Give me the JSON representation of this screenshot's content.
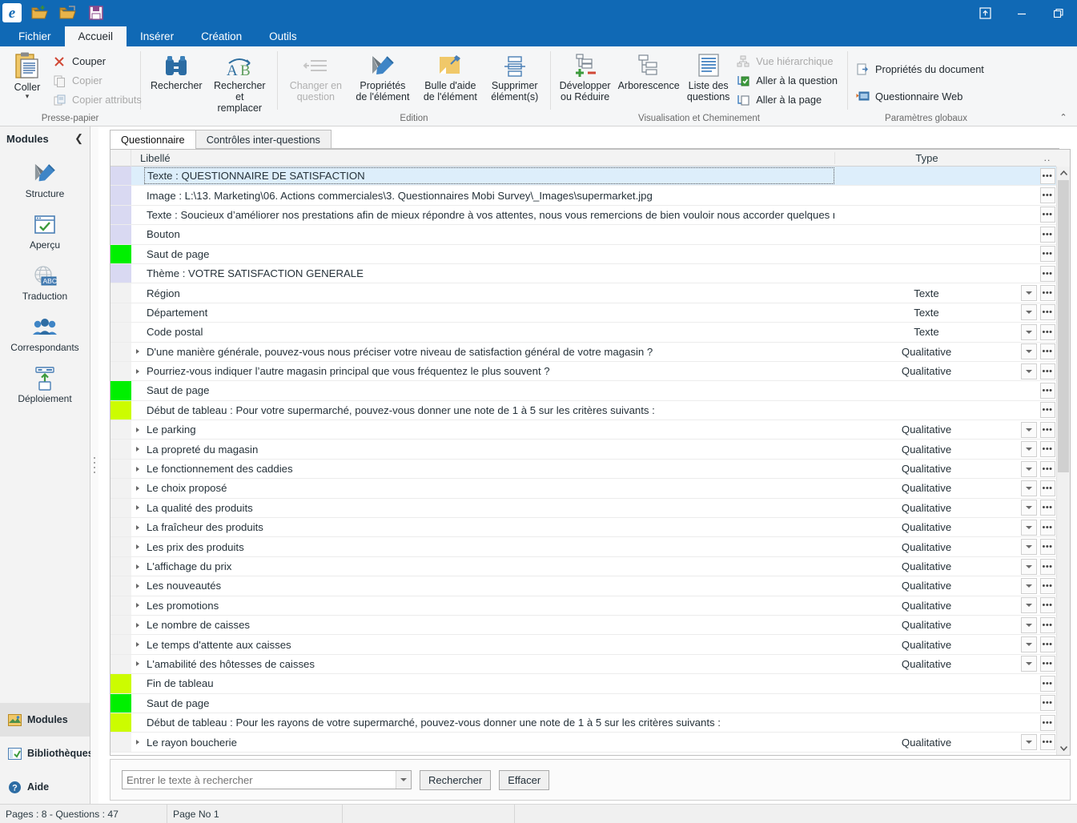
{
  "window": {
    "quick_access": [
      "app-logo",
      "open-icon",
      "open-recent-icon",
      "save-icon"
    ],
    "controls": [
      {
        "name": "restore-window-icon",
        "glyph": "⬒"
      },
      {
        "name": "minimize-window-icon",
        "glyph": "—"
      },
      {
        "name": "maximize-window-icon",
        "glyph": "❐"
      }
    ]
  },
  "ribbon": {
    "tabs": [
      {
        "label": "Fichier",
        "active": false
      },
      {
        "label": "Accueil",
        "active": true
      },
      {
        "label": "Insérer",
        "active": false
      },
      {
        "label": "Création",
        "active": false
      },
      {
        "label": "Outils",
        "active": false
      }
    ],
    "collapse_glyph": "⌃",
    "groups": [
      {
        "title": "Presse-papier",
        "big": [
          {
            "label": "Coller",
            "icon": "clipboard-paste-icon",
            "split": true,
            "disabled": false
          }
        ],
        "small": [
          {
            "label": "Couper",
            "icon": "cut-icon",
            "disabled": false
          },
          {
            "label": "Copier",
            "icon": "copy-icon",
            "disabled": true
          },
          {
            "label": "Copier attributs",
            "icon": "copy-attributes-icon",
            "disabled": true
          }
        ]
      },
      {
        "title": "",
        "big": [
          {
            "label": "Rechercher",
            "icon": "binoculars-icon",
            "disabled": false
          },
          {
            "label": "Rechercher\net remplacer",
            "label1": "Rechercher",
            "label2": "et remplacer",
            "icon": "find-replace-icon",
            "disabled": false
          }
        ],
        "small": []
      },
      {
        "title": "Edition",
        "big": [
          {
            "label1": "Changer en",
            "label2": "question",
            "icon": "change-to-question-icon",
            "disabled": true
          },
          {
            "label1": "Propriétés",
            "label2": "de l'élément",
            "icon": "element-properties-icon",
            "disabled": false
          },
          {
            "label1": "Bulle d'aide",
            "label2": "de l'élément",
            "icon": "tooltip-icon",
            "disabled": false
          },
          {
            "label1": "Supprimer",
            "label2": "élément(s)",
            "icon": "delete-element-icon",
            "disabled": false
          }
        ],
        "small": []
      },
      {
        "title": "Visualisation et Cheminement",
        "big": [
          {
            "label1": "Développer",
            "label2": "ou Réduire",
            "icon": "expand-collapse-icon",
            "disabled": false
          },
          {
            "label1": "Arborescence",
            "label2": "",
            "icon": "tree-view-icon",
            "disabled": false
          },
          {
            "label1": "Liste des",
            "label2": "questions",
            "icon": "question-list-icon",
            "disabled": false
          }
        ],
        "small": [
          {
            "label": "Vue hiérarchique",
            "icon": "hierarchy-view-icon",
            "disabled": true
          },
          {
            "label": "Aller à la question",
            "icon": "goto-question-icon",
            "disabled": false
          },
          {
            "label": "Aller à la page",
            "icon": "goto-page-icon",
            "disabled": false
          }
        ]
      },
      {
        "title": "Paramètres globaux",
        "big": [],
        "small": [
          {
            "label": "Propriétés du document",
            "icon": "document-properties-icon",
            "disabled": false
          },
          {
            "label": "Questionnaire Web",
            "icon": "web-questionnaire-icon",
            "disabled": false
          }
        ]
      }
    ]
  },
  "sidebar": {
    "title": "Modules",
    "collapse_glyph": "❮",
    "items": [
      {
        "label": "Structure",
        "icon": "structure-pencil-icon"
      },
      {
        "label": "Aperçu",
        "icon": "preview-check-icon"
      },
      {
        "label": "Traduction",
        "icon": "translation-globe-abc-icon"
      },
      {
        "label": "Correspondants",
        "icon": "contacts-people-icon"
      },
      {
        "label": "Déploiement",
        "icon": "deployment-upload-icon"
      }
    ],
    "bottom": [
      {
        "label": "Modules",
        "icon": "modules-icon",
        "selected": true
      },
      {
        "label": "Bibliothèques",
        "icon": "libraries-icon",
        "selected": false
      },
      {
        "label": "Aide",
        "icon": "help-icon",
        "selected": false
      }
    ]
  },
  "main": {
    "tabs": [
      {
        "label": "Questionnaire",
        "active": true
      },
      {
        "label": "Contrôles inter-questions",
        "active": false
      }
    ],
    "grid": {
      "columns": [
        "Libellé",
        "Type"
      ],
      "header_ellipsis": "..",
      "marker_colors": {
        "element": "#d9d9f2",
        "page_break": "#00f000",
        "table_bound": "#ccfc00",
        "question": "#f2f2f2",
        "none": "#ffffff"
      },
      "rows": [
        {
          "label": "Texte : QUESTIONNAIRE DE SATISFACTION",
          "type": "",
          "marker": "element",
          "expand": false,
          "dropdown": false,
          "selected": true
        },
        {
          "label": "Image : L:\\13. Marketing\\06. Actions commerciales\\3. Questionnaires Mobi Survey\\_Images\\supermarket.jpg",
          "type": "",
          "marker": "element",
          "expand": false,
          "dropdown": false,
          "selected": false
        },
        {
          "label": "Texte : Soucieux d’améliorer nos prestations afin de mieux répondre à vos attentes, nous vous remercions de bien vouloir nous accorder quelques min...",
          "type": "",
          "marker": "element",
          "expand": false,
          "dropdown": false,
          "selected": false
        },
        {
          "label": "Bouton",
          "type": "",
          "marker": "element",
          "expand": false,
          "dropdown": false,
          "selected": false
        },
        {
          "label": "Saut de page",
          "type": "",
          "marker": "page_break",
          "expand": false,
          "dropdown": false,
          "selected": false
        },
        {
          "label": "Thème : VOTRE SATISFACTION GENERALE",
          "type": "",
          "marker": "element",
          "expand": false,
          "dropdown": false,
          "selected": false
        },
        {
          "label": "Région",
          "type": "Texte",
          "marker": "question",
          "expand": false,
          "dropdown": true,
          "selected": false
        },
        {
          "label": "Département",
          "type": "Texte",
          "marker": "question",
          "expand": false,
          "dropdown": true,
          "selected": false
        },
        {
          "label": "Code postal",
          "type": "Texte",
          "marker": "question",
          "expand": false,
          "dropdown": true,
          "selected": false
        },
        {
          "label": "D'une manière générale, pouvez-vous nous préciser votre niveau de satisfaction général de votre magasin ?",
          "type": "Qualitative",
          "marker": "question",
          "expand": true,
          "dropdown": true,
          "selected": false
        },
        {
          "label": "Pourriez-vous indiquer l’autre magasin principal que vous fréquentez le plus souvent ?",
          "type": "Qualitative",
          "marker": "question",
          "expand": true,
          "dropdown": true,
          "selected": false
        },
        {
          "label": "Saut de page",
          "type": "",
          "marker": "page_break",
          "expand": false,
          "dropdown": false,
          "selected": false
        },
        {
          "label": "Début de tableau : Pour votre supermarché, pouvez-vous donner une note de 1 à 5 sur les critères suivants :",
          "type": "",
          "marker": "table_bound",
          "expand": false,
          "dropdown": false,
          "selected": false
        },
        {
          "label": "Le parking",
          "type": "Qualitative",
          "marker": "question",
          "expand": true,
          "dropdown": true,
          "selected": false
        },
        {
          "label": "La propreté du magasin",
          "type": "Qualitative",
          "marker": "question",
          "expand": true,
          "dropdown": true,
          "selected": false
        },
        {
          "label": "Le fonctionnement des caddies",
          "type": "Qualitative",
          "marker": "question",
          "expand": true,
          "dropdown": true,
          "selected": false
        },
        {
          "label": "Le choix proposé",
          "type": "Qualitative",
          "marker": "question",
          "expand": true,
          "dropdown": true,
          "selected": false
        },
        {
          "label": "La qualité des produits",
          "type": "Qualitative",
          "marker": "question",
          "expand": true,
          "dropdown": true,
          "selected": false
        },
        {
          "label": "La fraîcheur des produits",
          "type": "Qualitative",
          "marker": "question",
          "expand": true,
          "dropdown": true,
          "selected": false
        },
        {
          "label": "Les prix des produits",
          "type": "Qualitative",
          "marker": "question",
          "expand": true,
          "dropdown": true,
          "selected": false
        },
        {
          "label": "L'affichage du prix",
          "type": "Qualitative",
          "marker": "question",
          "expand": true,
          "dropdown": true,
          "selected": false
        },
        {
          "label": "Les nouveautés",
          "type": "Qualitative",
          "marker": "question",
          "expand": true,
          "dropdown": true,
          "selected": false
        },
        {
          "label": "Les promotions",
          "type": "Qualitative",
          "marker": "question",
          "expand": true,
          "dropdown": true,
          "selected": false
        },
        {
          "label": "Le nombre de caisses",
          "type": "Qualitative",
          "marker": "question",
          "expand": true,
          "dropdown": true,
          "selected": false
        },
        {
          "label": "Le temps d'attente aux caisses",
          "type": "Qualitative",
          "marker": "question",
          "expand": true,
          "dropdown": true,
          "selected": false
        },
        {
          "label": "L'amabilité des hôtesses de caisses",
          "type": "Qualitative",
          "marker": "question",
          "expand": true,
          "dropdown": true,
          "selected": false
        },
        {
          "label": "Fin de tableau",
          "type": "",
          "marker": "table_bound",
          "expand": false,
          "dropdown": false,
          "selected": false
        },
        {
          "label": "Saut de page",
          "type": "",
          "marker": "page_break",
          "expand": false,
          "dropdown": false,
          "selected": false
        },
        {
          "label": "Début de tableau : Pour les rayons de votre supermarché, pouvez-vous donner une note de 1 à 5 sur les critères suivants :",
          "type": "",
          "marker": "table_bound",
          "expand": false,
          "dropdown": false,
          "selected": false
        },
        {
          "label": "Le rayon boucherie",
          "type": "Qualitative",
          "marker": "question",
          "expand": true,
          "dropdown": true,
          "selected": false
        }
      ]
    },
    "search": {
      "placeholder": "Entrer le texte à rechercher",
      "value": "",
      "find_label": "Rechercher",
      "clear_label": "Effacer"
    }
  },
  "statusbar": {
    "cells": [
      "Pages : 8 - Questions : 47",
      "Page No 1",
      "",
      ""
    ]
  }
}
